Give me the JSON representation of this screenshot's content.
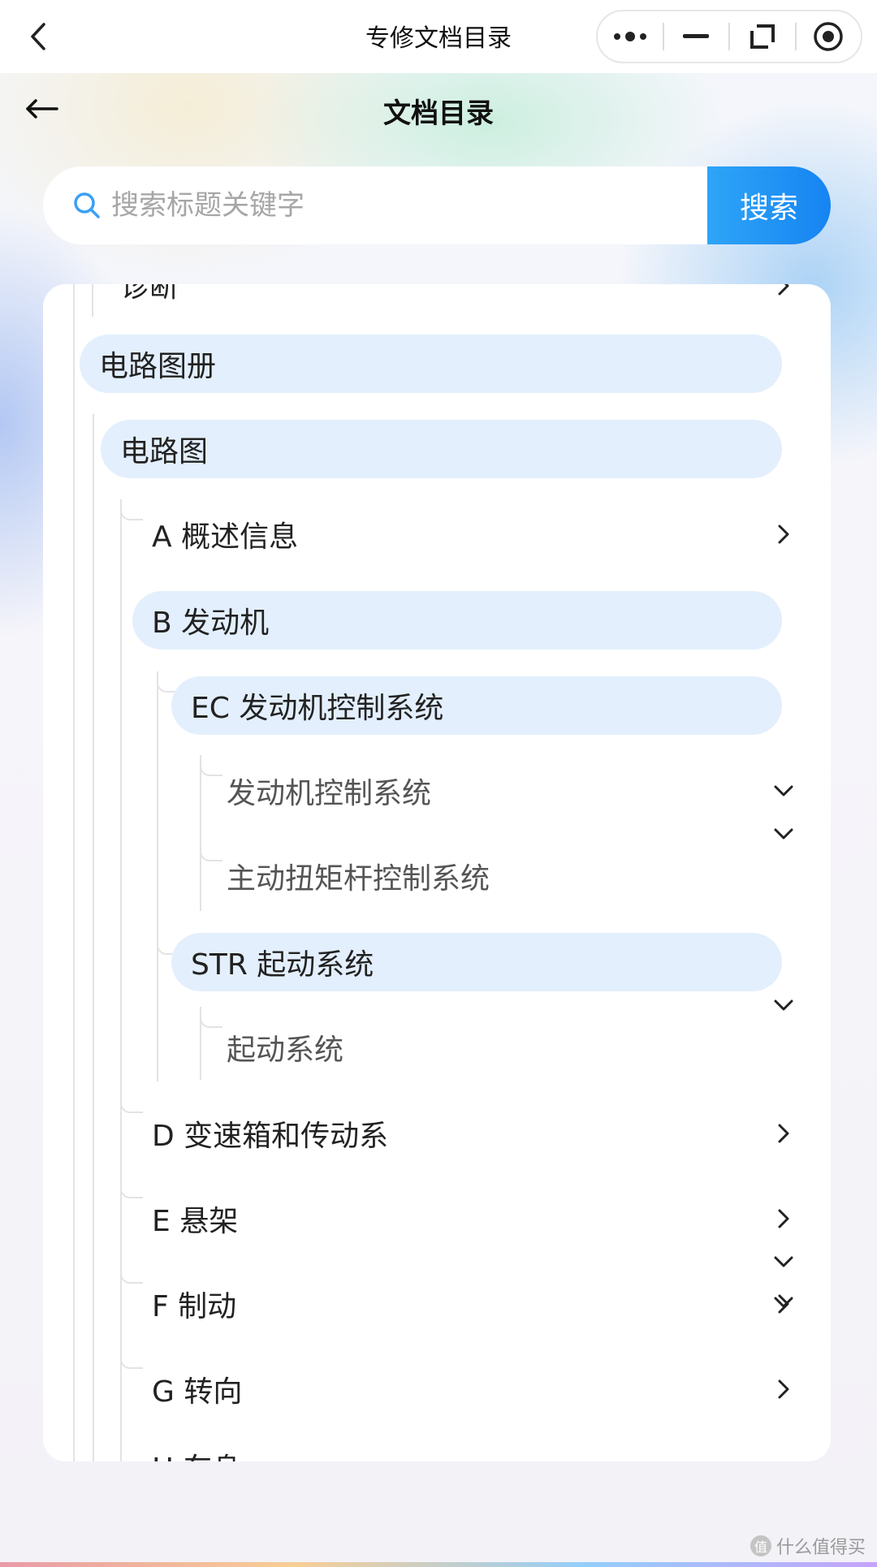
{
  "topbar": {
    "title": "专修文档目录"
  },
  "header": {
    "title": "文档目录"
  },
  "search": {
    "placeholder": "搜索标题关键字",
    "button_label": "搜索"
  },
  "tree": {
    "partial_top": "诊断",
    "items": [
      {
        "label": "电路图册",
        "level": 0,
        "highlight": true
      },
      {
        "label": "电路图",
        "level": 1,
        "highlight": true
      },
      {
        "label": "A 概述信息",
        "level": 2,
        "chevron": "right"
      },
      {
        "label": "B 发动机",
        "level": 2,
        "highlight": true
      },
      {
        "label": "EC 发动机控制系统",
        "level": 3,
        "highlight": true
      },
      {
        "label": "发动机控制系统",
        "level": 4,
        "chevron": "down"
      },
      {
        "label": "主动扭矩杆控制系统",
        "level": 4,
        "chevron": "down"
      },
      {
        "label": "STR 起动系统",
        "level": 3,
        "highlight": true
      },
      {
        "label": "起动系统",
        "level": 4,
        "chevron": "down"
      },
      {
        "label": "D 变速箱和传动系",
        "level": 2,
        "chevron": "right"
      },
      {
        "label": "E 悬架",
        "level": 2,
        "chevron": "right"
      },
      {
        "label": "F 制动",
        "level": 2,
        "chevron": "right"
      },
      {
        "label": "G 转向",
        "level": 2,
        "chevron": "right"
      }
    ],
    "partial_bottom": "H 车身"
  },
  "watermark": {
    "text": "什么值得买",
    "logo": "值"
  },
  "colors": {
    "accent": "#1684f2",
    "highlight_bg": "#e3effd",
    "tree_line": "#e3e3e3"
  }
}
